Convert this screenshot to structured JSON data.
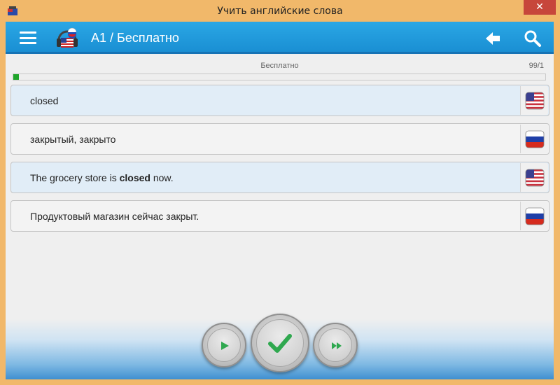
{
  "window": {
    "title": "Учить английские слова",
    "close_label": "✕"
  },
  "appbar": {
    "title": "A1 / Бесплатно"
  },
  "progress": {
    "label": "Бесплатно",
    "count": "99/1",
    "fraction": 0.01
  },
  "cards": [
    {
      "text": "closed",
      "lang": "en"
    },
    {
      "text": "закрытый, закрыто",
      "lang": "ru"
    },
    {
      "text_before": "The grocery store is ",
      "text_bold": "closed",
      "text_after": " now.",
      "lang": "en"
    },
    {
      "text": "Продуктовый магазин сейчас закрыт.",
      "lang": "ru"
    }
  ],
  "colors": {
    "appbar": "#1a8fd3",
    "progress_fill": "#1fa52b",
    "check": "#2fa84f"
  }
}
